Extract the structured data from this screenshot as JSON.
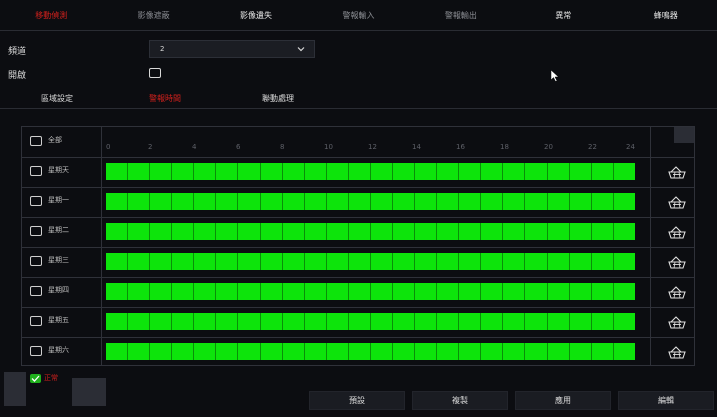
{
  "tabs": [
    {
      "label": "移動偵測",
      "state": "active"
    },
    {
      "label": "影像遮蔽",
      "state": "dim"
    },
    {
      "label": "影像遺失",
      "state": "bright"
    },
    {
      "label": "警報輸入",
      "state": "dim"
    },
    {
      "label": "警報輸出",
      "state": "dim"
    },
    {
      "label": "異常",
      "state": "bright"
    },
    {
      "label": "蜂鳴器",
      "state": "bright"
    }
  ],
  "form": {
    "channel_label": "頻道",
    "channel_value": "2",
    "enable_label": "開啟"
  },
  "subtabs": {
    "area": "區域設定",
    "schedule": "警報時間",
    "linkage": "聯動處理"
  },
  "schedule": {
    "all_label": "全部",
    "hour_ticks": [
      "0",
      "2",
      "4",
      "6",
      "8",
      "10",
      "12",
      "14",
      "16",
      "18",
      "20",
      "22",
      "24"
    ],
    "days": [
      {
        "name": "星期天",
        "coverage": 1.0
      },
      {
        "name": "星期一",
        "coverage": 1.0
      },
      {
        "name": "星期二",
        "coverage": 1.0
      },
      {
        "name": "星期三",
        "coverage": 1.0
      },
      {
        "name": "星期四",
        "coverage": 1.0
      },
      {
        "name": "星期五",
        "coverage": 1.0
      },
      {
        "name": "星期六",
        "coverage": 1.0
      }
    ],
    "segments_per_day": 24
  },
  "legend": {
    "normal_label": "正常"
  },
  "buttons": {
    "default": "預設",
    "copy": "複製",
    "apply": "應用",
    "edit": "編輯"
  },
  "colors": {
    "active_red": "#d0201c",
    "schedule_green": "#0de40b",
    "background": "#0c0d11"
  },
  "icons": [
    "chevron-down-icon",
    "eraser-icon",
    "mouse-cursor-icon",
    "checkbox-icon"
  ]
}
